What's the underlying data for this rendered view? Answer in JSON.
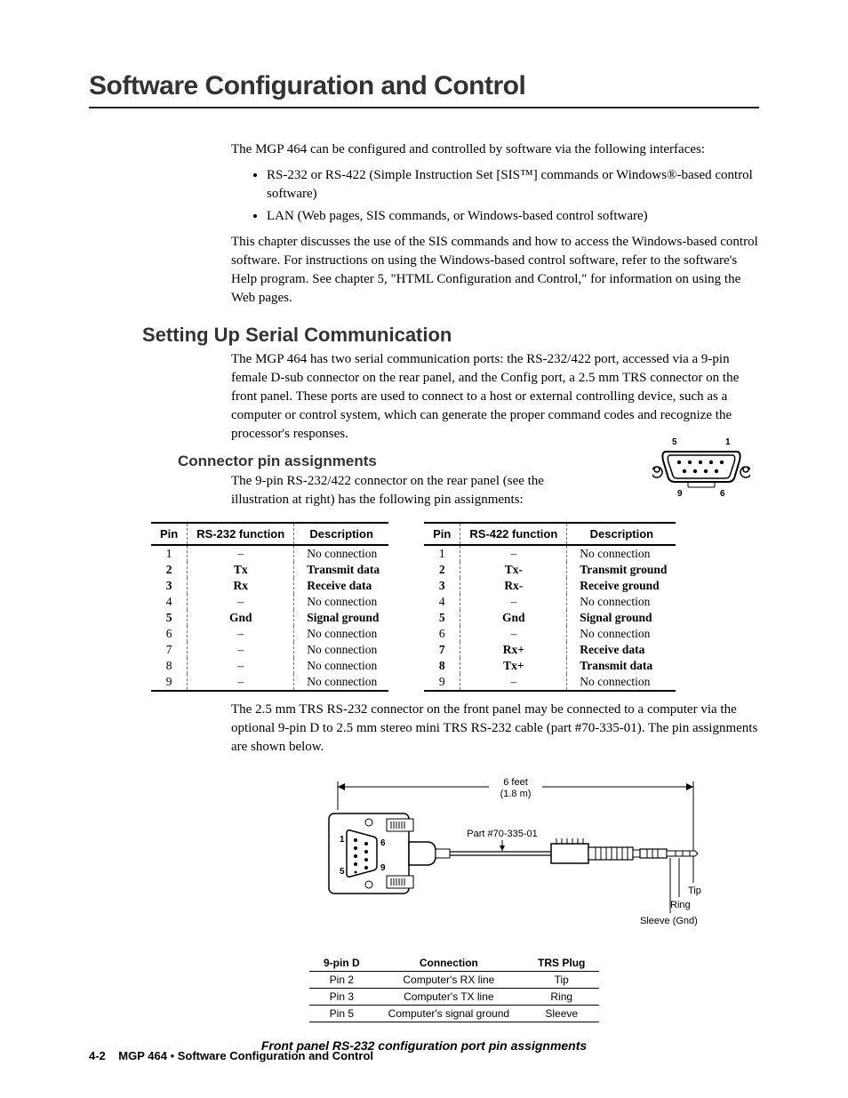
{
  "title": "Software Configuration and Control",
  "intro_p1": "The MGP 464 can be configured and controlled by software via the following interfaces:",
  "bullets": [
    "RS-232 or RS-422 (Simple Instruction Set [SIS™] commands or Windows®-based control software)",
    "LAN (Web pages, SIS commands, or Windows-based control software)"
  ],
  "intro_p2": "This chapter discusses the use of the SIS commands and how to access the Windows-based control software.  For instructions on using the Windows-based control software, refer to the software's Help program.  See chapter 5, \"HTML Configuration and Control,\" for information on using the Web pages.",
  "section_h2": "Setting Up Serial Communication",
  "section_p": "The MGP 464 has two serial communication ports: the RS-232/422 port, accessed via a 9-pin female D-sub connector on the rear panel, and the Config port, a 2.5 mm TRS connector on the front panel.  These ports are used to connect to a host or external controlling device, such as a computer or control system, which can generate the proper command codes and recognize the processor's responses.",
  "subsection_h3": "Connector pin assignments",
  "subsection_p": "The 9-pin RS-232/422 connector on the rear panel (see the illustration at right) has the following pin assignments:",
  "connector_labels": {
    "tl": "5",
    "tr": "1",
    "bl": "9",
    "br": "6"
  },
  "table232": {
    "headers": [
      "Pin",
      "RS-232 function",
      "Description"
    ],
    "rows": [
      {
        "pin": "1",
        "func": "–",
        "desc": "No connection",
        "bold": false
      },
      {
        "pin": "2",
        "func": "Tx",
        "desc": "Transmit data",
        "bold": true
      },
      {
        "pin": "3",
        "func": "Rx",
        "desc": "Receive data",
        "bold": true
      },
      {
        "pin": "4",
        "func": "–",
        "desc": "No connection",
        "bold": false
      },
      {
        "pin": "5",
        "func": "Gnd",
        "desc": "Signal ground",
        "bold": true
      },
      {
        "pin": "6",
        "func": "–",
        "desc": "No connection",
        "bold": false
      },
      {
        "pin": "7",
        "func": "–",
        "desc": "No connection",
        "bold": false
      },
      {
        "pin": "8",
        "func": "–",
        "desc": "No connection",
        "bold": false
      },
      {
        "pin": "9",
        "func": "–",
        "desc": "No connection",
        "bold": false
      }
    ]
  },
  "table422": {
    "headers": [
      "Pin",
      "RS-422 function",
      "Description"
    ],
    "rows": [
      {
        "pin": "1",
        "func": "–",
        "desc": "No connection",
        "bold": false
      },
      {
        "pin": "2",
        "func": "Tx-",
        "desc": "Transmit ground",
        "bold": true
      },
      {
        "pin": "3",
        "func": "Rx-",
        "desc": "Receive ground",
        "bold": true
      },
      {
        "pin": "4",
        "func": "–",
        "desc": "No connection",
        "bold": false
      },
      {
        "pin": "5",
        "func": "Gnd",
        "desc": "Signal ground",
        "bold": true
      },
      {
        "pin": "6",
        "func": "–",
        "desc": "No connection",
        "bold": false
      },
      {
        "pin": "7",
        "func": "Rx+",
        "desc": "Receive data",
        "bold": true
      },
      {
        "pin": "8",
        "func": "Tx+",
        "desc": "Transmit data",
        "bold": true
      },
      {
        "pin": "9",
        "func": "–",
        "desc": "No connection",
        "bold": false
      }
    ]
  },
  "trs_p": "The 2.5 mm TRS RS-232 connector on the front panel may be connected to a computer via the optional 9-pin D to 2.5 mm stereo mini TRS RS-232 cable (part #70-335-01).  The pin assignments are shown below.",
  "diagram": {
    "len_label": "6 feet",
    "len_sub": "(1.8 m)",
    "part": "Part #70-335-01",
    "pin1": "1",
    "pin6": "6",
    "pin5": "5",
    "pin9": "9",
    "tip": "Tip",
    "ring": "Ring",
    "sleeve": "Sleeve (Gnd)"
  },
  "trs_table": {
    "headers": [
      "9-pin D",
      "Connection",
      "TRS Plug"
    ],
    "rows": [
      {
        "a": "Pin 2",
        "b": "Computer's RX line",
        "c": "Tip"
      },
      {
        "a": "Pin 3",
        "b": "Computer's TX line",
        "c": "Ring"
      },
      {
        "a": "Pin 5",
        "b": "Computer's signal ground",
        "c": "Sleeve"
      }
    ]
  },
  "caption": "Front panel RS-232 configuration port pin assignments",
  "footer": {
    "page": "4-2",
    "product": "MGP 464",
    "section": "Software Configuration and Control"
  }
}
